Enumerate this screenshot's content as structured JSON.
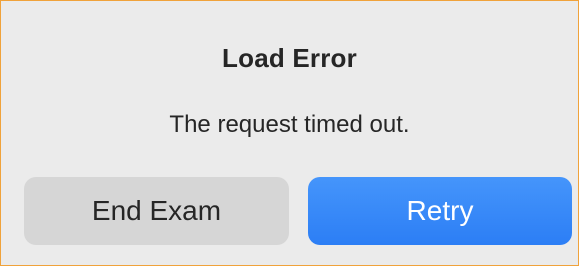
{
  "dialog": {
    "title": "Load Error",
    "message": "The request timed out.",
    "buttons": {
      "end_exam": "End Exam",
      "retry": "Retry"
    }
  },
  "colors": {
    "frame_border": "#f0a23a",
    "dialog_background": "#ebebeb",
    "secondary_button": "#d6d6d6",
    "primary_button": "#3a89f8",
    "text": "#262626"
  }
}
